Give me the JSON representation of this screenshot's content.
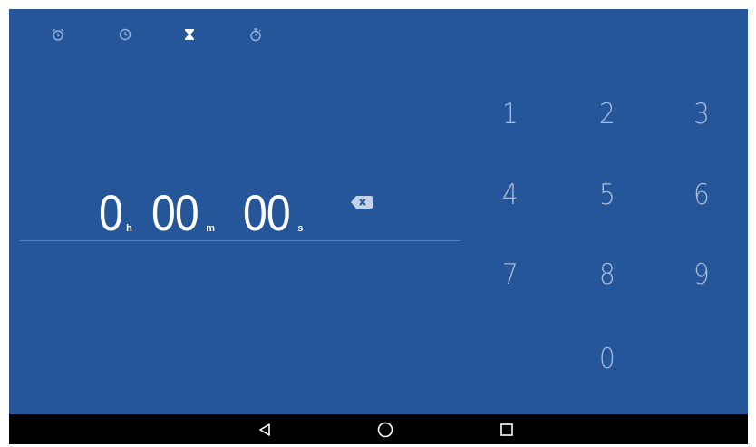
{
  "tabs": [
    {
      "name": "alarm",
      "icon": "alarm-icon",
      "selected": false
    },
    {
      "name": "clock",
      "icon": "clock-icon",
      "selected": false
    },
    {
      "name": "timer",
      "icon": "hourglass-icon",
      "selected": true
    },
    {
      "name": "stopwatch",
      "icon": "stopwatch-icon",
      "selected": false
    }
  ],
  "timer": {
    "hours": "0",
    "hours_unit": "h",
    "minutes": "00",
    "minutes_unit": "m",
    "seconds": "00",
    "seconds_unit": "s"
  },
  "keypad": {
    "k1": "1",
    "k2": "2",
    "k3": "3",
    "k4": "4",
    "k5": "5",
    "k6": "6",
    "k7": "7",
    "k8": "8",
    "k9": "9",
    "k0": "0"
  },
  "colors": {
    "background": "#245699",
    "keypad_text": "#a9bcd8",
    "tab_inactive": "#8fb0dc",
    "tab_active": "#ffffff",
    "navbar": "#000000"
  },
  "navbar": {
    "back_icon": "back-triangle-icon",
    "home_icon": "home-circle-icon",
    "recents_icon": "recents-square-icon"
  }
}
